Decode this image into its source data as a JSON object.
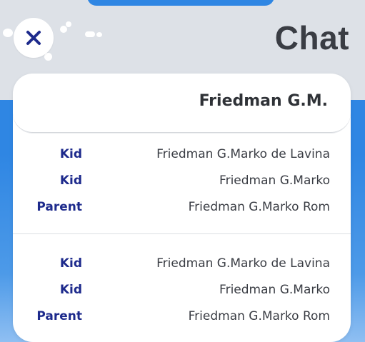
{
  "header": {
    "title": "Chat",
    "close_icon": "close-icon"
  },
  "card": {
    "name": "Friedman G.M.",
    "groups": [
      {
        "rows": [
          {
            "role": "Kid",
            "name": "Friedman G.Marko de Lavina"
          },
          {
            "role": "Kid",
            "name": "Friedman G.Marko"
          },
          {
            "role": "Parent",
            "name": "Friedman G.Marko Rom"
          }
        ]
      },
      {
        "rows": [
          {
            "role": "Kid",
            "name": "Friedman G.Marko de Lavina"
          },
          {
            "role": "Kid",
            "name": "Friedman G.Marko"
          },
          {
            "role": "Parent",
            "name": "Friedman G.Marko Rom"
          }
        ]
      }
    ]
  },
  "colors": {
    "background_blue": "#2f86e3",
    "topbar_gray": "#dde1e7",
    "role_navy": "#1d2a8c",
    "text_dark": "#3a3d44"
  }
}
